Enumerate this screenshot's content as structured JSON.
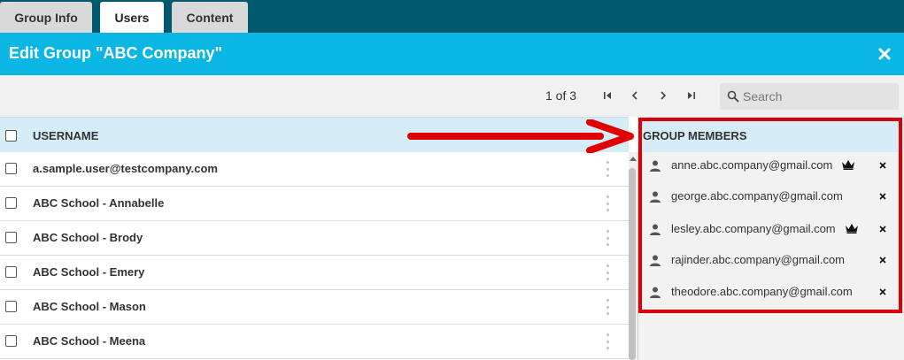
{
  "tabs": [
    {
      "label": "Group Info",
      "active": false
    },
    {
      "label": "Users",
      "active": true
    },
    {
      "label": "Content",
      "active": false
    }
  ],
  "header": {
    "title": "Edit Group \"ABC Company\"",
    "close_icon": "close-icon",
    "color": "#0ab6e3"
  },
  "pager": {
    "text": "1 of 3"
  },
  "search": {
    "placeholder": "Search",
    "value": ""
  },
  "list": {
    "column_header": "USERNAME",
    "rows": [
      {
        "name": "a.sample.user@testcompany.com"
      },
      {
        "name": "ABC School - Annabelle"
      },
      {
        "name": "ABC School - Brody"
      },
      {
        "name": "ABC School - Emery"
      },
      {
        "name": "ABC School - Mason"
      },
      {
        "name": "ABC School - Meena"
      }
    ]
  },
  "members": {
    "title": "GROUP MEMBERS",
    "items": [
      {
        "email": "anne.abc.company@gmail.com",
        "owner": true
      },
      {
        "email": "george.abc.company@gmail.com",
        "owner": false
      },
      {
        "email": "lesley.abc.company@gmail.com",
        "owner": true
      },
      {
        "email": "rajinder.abc.company@gmail.com",
        "owner": false
      },
      {
        "email": "theodore.abc.company@gmail.com",
        "owner": false
      }
    ]
  },
  "colors": {
    "tabbar": "#005a6e",
    "header": "#0ab6e3",
    "list_header": "#d6ecf7",
    "highlight": "#e00000"
  }
}
